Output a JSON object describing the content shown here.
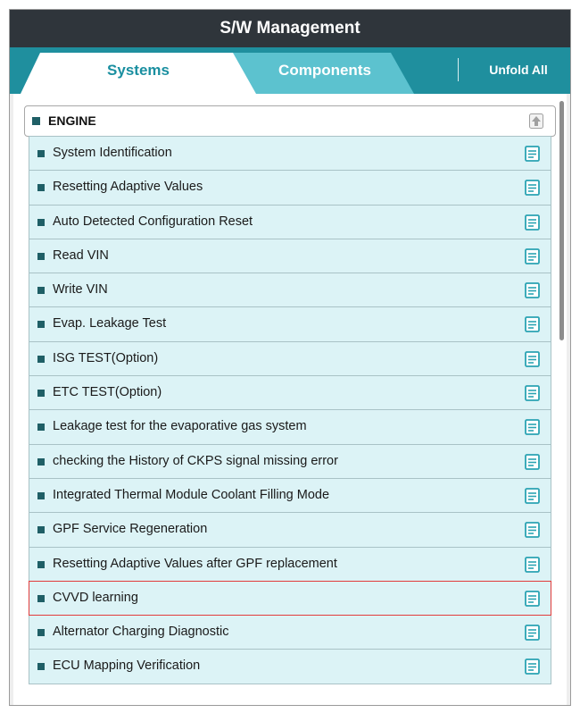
{
  "title": "S/W Management",
  "tabs": [
    {
      "label": "Systems",
      "active": true
    },
    {
      "label": "Components",
      "active": false
    }
  ],
  "unfold_all_label": "Unfold All",
  "section": {
    "title": "ENGINE",
    "collapse_icon": "collapse-up-icon"
  },
  "items": [
    {
      "label": "System Identification",
      "icon": "document-icon"
    },
    {
      "label": "Resetting Adaptive Values",
      "icon": "document-icon"
    },
    {
      "label": "Auto Detected Configuration Reset",
      "icon": "document-icon"
    },
    {
      "label": "Read VIN",
      "icon": "document-icon"
    },
    {
      "label": "Write VIN",
      "icon": "document-icon"
    },
    {
      "label": "Evap. Leakage Test",
      "icon": "document-icon"
    },
    {
      "label": "ISG TEST(Option)",
      "icon": "document-icon"
    },
    {
      "label": "ETC TEST(Option)",
      "icon": "document-icon"
    },
    {
      "label": "Leakage test for the evaporative gas system",
      "icon": "document-icon"
    },
    {
      "label": "checking the History of  CKPS signal missing error",
      "icon": "document-icon"
    },
    {
      "label": "Integrated Thermal Module Coolant Filling Mode",
      "icon": "document-icon"
    },
    {
      "label": "GPF Service Regeneration",
      "icon": "document-icon"
    },
    {
      "label": "Resetting Adaptive Values after GPF replacement",
      "icon": "document-icon"
    },
    {
      "label": "CVVD learning",
      "icon": "document-icon",
      "selected": true
    },
    {
      "label": "Alternator Charging Diagnostic",
      "icon": "document-icon"
    },
    {
      "label": "ECU Mapping Verification",
      "icon": "document-icon"
    }
  ],
  "colors": {
    "title_bar": "#2f353b",
    "tab_bar": "#1f8f9e",
    "item_bg": "#dcf3f6",
    "icon": "#2aa3b3",
    "selected_border": "#e23b3b"
  }
}
